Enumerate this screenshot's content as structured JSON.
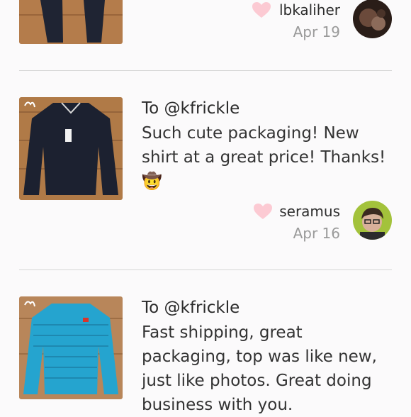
{
  "reviews": [
    {
      "username": "lbkaliher",
      "date": "Apr 19",
      "to": "",
      "message": "",
      "emoji": ""
    },
    {
      "username": "seramus",
      "date": "Apr 16",
      "to": "To @kfrickle",
      "message": "Such cute packaging! New shirt at a great price! Thanks!",
      "emoji": "🤠"
    },
    {
      "username": "",
      "date": "",
      "to": "To @kfrickle",
      "message": "Fast shipping, great packaging, top was like new, just like photos. Great doing business with you.",
      "emoji": ""
    }
  ],
  "icons": {
    "like": "heart-icon"
  },
  "colors": {
    "heart": "#fccad3",
    "divider": "#d7d7d7",
    "date": "#9a9a9a"
  }
}
